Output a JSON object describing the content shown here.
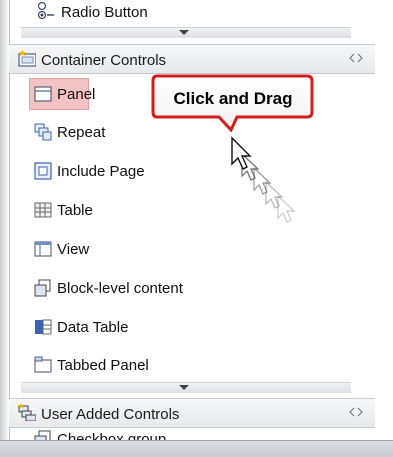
{
  "palette": {
    "top_item": {
      "label": "Radio Button",
      "icon": "radio-button-icon"
    },
    "container_section": {
      "title": "Container Controls",
      "icon": "container-folder-icon",
      "items": [
        {
          "label": "Panel",
          "icon": "panel-icon",
          "selected": true
        },
        {
          "label": "Repeat",
          "icon": "repeat-icon"
        },
        {
          "label": "Include Page",
          "icon": "include-page-icon"
        },
        {
          "label": "Table",
          "icon": "table-icon"
        },
        {
          "label": "View",
          "icon": "view-icon"
        },
        {
          "label": "Block-level content",
          "icon": "block-content-icon"
        },
        {
          "label": "Data Table",
          "icon": "data-table-icon"
        },
        {
          "label": "Tabbed Panel",
          "icon": "tabbed-panel-icon"
        }
      ]
    },
    "user_section": {
      "title": "User Added Controls",
      "icon": "user-controls-icon",
      "items": [
        {
          "label": "Checkbox group",
          "icon": "checkbox-group-icon"
        }
      ]
    }
  },
  "callout": {
    "text": "Click and Drag",
    "color": "#e02424"
  },
  "colors": {
    "selection": "#f3c3c3",
    "callout_border": "#d11f1f"
  }
}
